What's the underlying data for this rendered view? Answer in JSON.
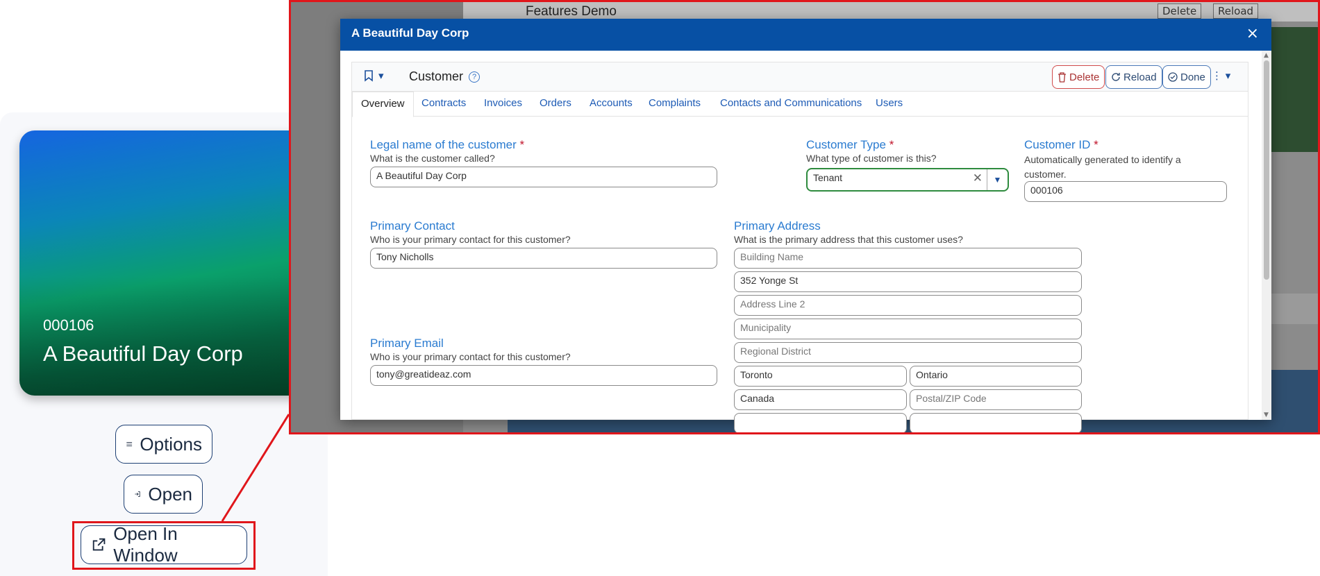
{
  "card": {
    "id": "000106",
    "name": "A Beautiful Day Corp",
    "options_label": "Options",
    "open_label": "Open",
    "open_window_label": "Open In Window"
  },
  "background": {
    "title": "Features Demo",
    "delete_label": "Delete",
    "reload_label": "Reload"
  },
  "modal": {
    "title": "A Beautiful Day Corp",
    "close": "×",
    "entity": "Customer",
    "help": "?",
    "delete_label": "Delete",
    "reload_label": "Reload",
    "done_label": "Done",
    "more": "⋮ ▾",
    "bookmark_caret": "▾"
  },
  "tabs": [
    "Overview",
    "Contracts",
    "Invoices",
    "Orders",
    "Accounts",
    "Complaints",
    "Contacts and Communications",
    "Users"
  ],
  "form": {
    "legal_name": {
      "label": "Legal name of the customer",
      "hint": "What is the customer called?",
      "value": "A Beautiful Day Corp"
    },
    "customer_type": {
      "label": "Customer Type",
      "hint": "What type of customer is this?",
      "value": "Tenant"
    },
    "customer_id": {
      "label": "Customer ID",
      "hint": "Automatically generated to identify a customer.",
      "value": "000106"
    },
    "primary_contact": {
      "label": "Primary Contact",
      "hint": "Who is your primary contact for this customer?",
      "value": "Tony Nicholls"
    },
    "primary_email": {
      "label": "Primary Email",
      "hint": "Who is your primary contact for this customer?",
      "value": "tony@greatideaz.com"
    },
    "primary_address": {
      "label": "Primary Address",
      "hint": "What is the primary address that this customer uses?",
      "building_placeholder": "Building Name",
      "line1": "352 Yonge St",
      "line2_placeholder": "Address Line 2",
      "municipality_placeholder": "Municipality",
      "regional_placeholder": "Regional District",
      "city": "Toronto",
      "province": "Ontario",
      "country": "Canada",
      "postal_placeholder": "Postal/ZIP Code"
    },
    "required_mark": "*"
  },
  "colors": {
    "highlight": "#e0161b",
    "modal_header": "#0750a4",
    "link": "#2a7bd0"
  }
}
